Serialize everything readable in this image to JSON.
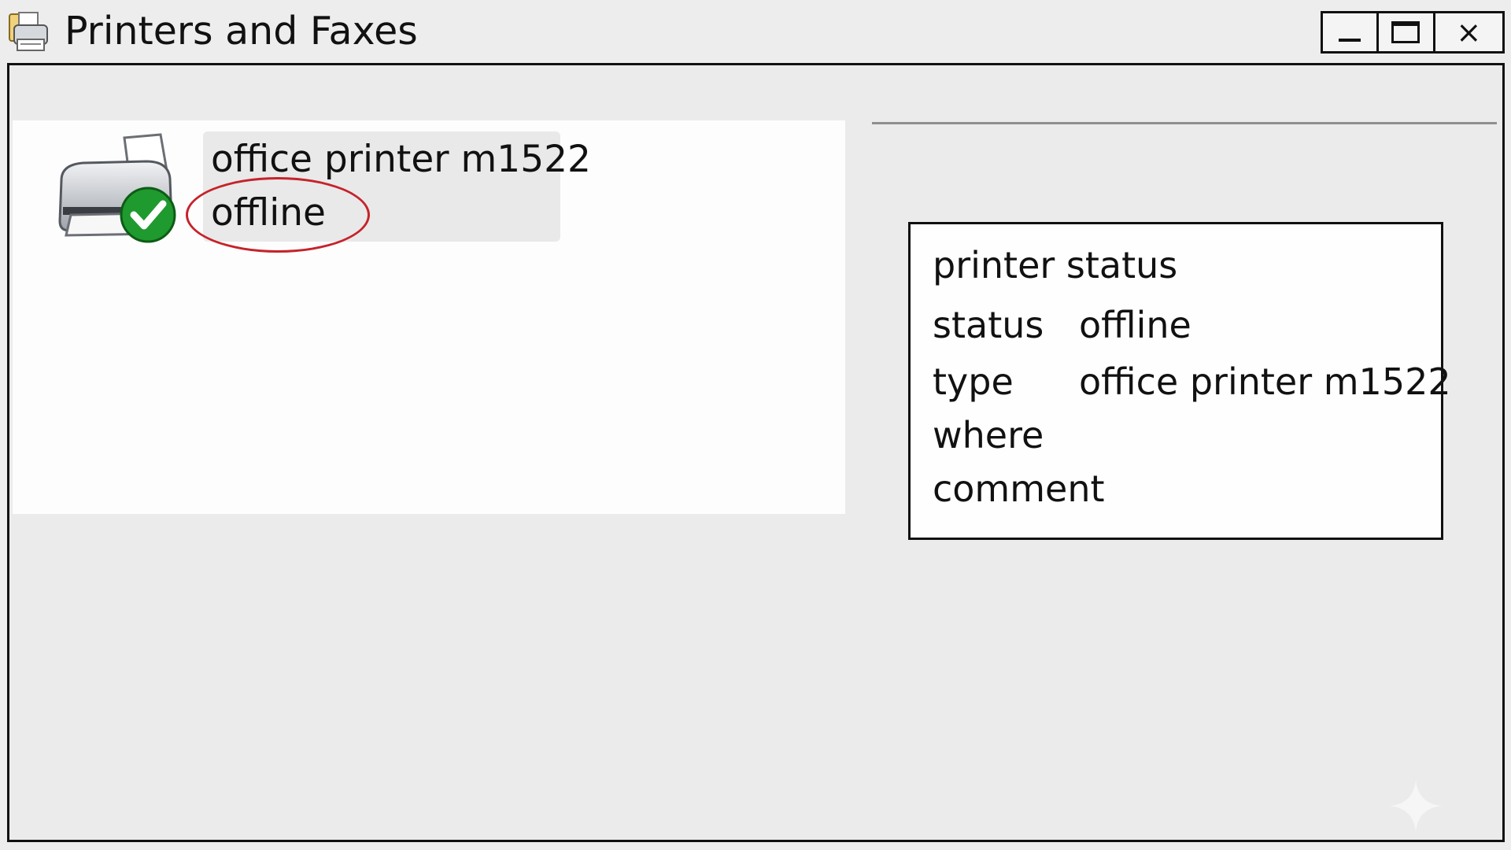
{
  "window": {
    "title": "Printers and Faxes",
    "close_glyph": "×",
    "app_icon": "printer-folder-icon"
  },
  "printers": [
    {
      "name": "office printer m1522",
      "state": "offline",
      "icon": "printer-icon",
      "badge_icon": "default-check-icon",
      "state_annotated": true
    }
  ],
  "details": {
    "heading": "printer status",
    "rows": [
      {
        "label": "status",
        "value": "offline"
      },
      {
        "label": "type",
        "value": "office printer m1522"
      },
      {
        "label": "where",
        "value": ""
      },
      {
        "label": "comment",
        "value": ""
      }
    ]
  },
  "colors": {
    "annotation": "#c5232b",
    "check_badge": "#1f9a2e",
    "window_background": "#ededed"
  }
}
